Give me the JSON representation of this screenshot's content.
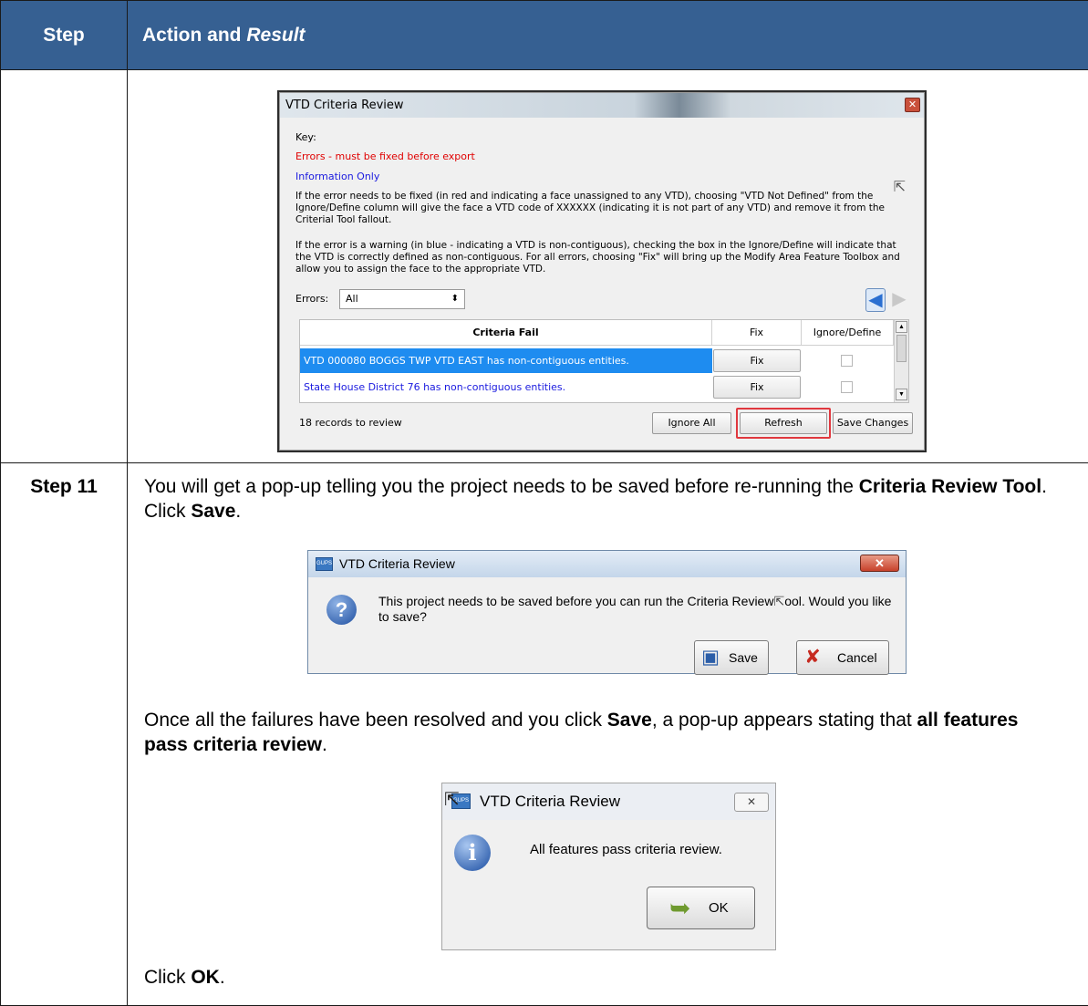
{
  "table": {
    "header_step": "Step",
    "header_action": "Action and",
    "header_action_em": "Result"
  },
  "vtd_window": {
    "title": "VTD Criteria Review",
    "key_label": "Key:",
    "errors_line": "Errors - must be fixed before export",
    "info_line": "Information Only",
    "para1": "If the error needs to be fixed (in red and indicating a face unassigned to any VTD), choosing \"VTD Not Defined\" from the Ignore/Define column will give the face a VTD code of XXXXXX (indicating it is not part of any VTD) and remove it from the Criterial Tool fallout.",
    "para2": "If the error is a warning (in blue - indicating a VTD is non-contiguous), checking the box in the Ignore/Define will indicate that the VTD is correctly defined as non-contiguous. For all errors, choosing \"Fix\" will bring up the Modify Area Feature Toolbox and allow you to assign the face to the appropriate VTD.",
    "errors_label": "Errors:",
    "errors_select_value": "All",
    "grid": {
      "col_criteria": "Criteria Fail",
      "col_fix": "Fix",
      "col_ignore": "Ignore/Define",
      "rows": [
        {
          "text": "VTD 000080 BOGGS TWP VTD EAST has non-contiguous entities.",
          "fix": "Fix"
        },
        {
          "text": "State House District 76 has non-contiguous entities.",
          "fix": "Fix"
        }
      ]
    },
    "records": "18  records to review",
    "btn_ignore_all": "Ignore All",
    "btn_refresh": "Refresh",
    "btn_save_changes": "Save Changes",
    "colors": {
      "error": "#e00000",
      "info": "#1a1adf",
      "selected_row": "#1e8cf0",
      "highlight": "#e0383e"
    }
  },
  "step11": {
    "label": "Step 11",
    "intro_a": "You will get a pop-up telling you the project needs to be saved before re-running the ",
    "intro_b": "Criteria Review Tool",
    "intro_c": ". Click ",
    "intro_d": "Save",
    "intro_e": ".",
    "mid_a": "Once all the failures have been resolved and you click ",
    "mid_b": "Save",
    "mid_c": ", a pop-up appears stating that ",
    "mid_d": "all features pass criteria review",
    "mid_e": ".",
    "end_a": "Click ",
    "end_b": "OK",
    "end_c": "."
  },
  "save_popup": {
    "title": "VTD Criteria Review",
    "message_a": "This project needs to be saved before you can run the Criteria Review",
    "message_b": "ool. Would you like to save?",
    "btn_save": "Save",
    "btn_cancel": "Cancel"
  },
  "ok_popup": {
    "title": "VTD Criteria Review",
    "message": "All features pass criteria review.",
    "btn_ok": "OK"
  },
  "colors": {
    "header_bg": "#366092"
  }
}
